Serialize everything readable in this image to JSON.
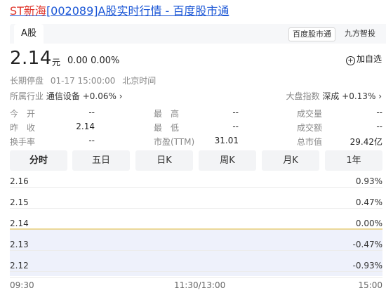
{
  "title": {
    "name_red": "ST新海",
    "rest": "[002089]A股实时行情 - 百度股市通"
  },
  "tabs": {
    "active": "A股",
    "source_primary": "百度股市通",
    "source_secondary": "九方智投"
  },
  "quote": {
    "price": "2.14",
    "unit": "元",
    "change": "0.00 0.00%",
    "add_label": "加自选",
    "status": [
      "长期停盘",
      "01-17 15:00:00",
      "北京时间"
    ],
    "industry_label": "所属行业",
    "industry_name": "通信设备",
    "industry_change": "+0.06%",
    "index_label": "大盘指数",
    "index_name": "深成",
    "index_change": "+0.13%"
  },
  "stats": [
    {
      "label": "今　开",
      "value": "--"
    },
    {
      "label": "最　高",
      "value": "--"
    },
    {
      "label": "成交量",
      "value": "--"
    },
    {
      "label": "昨　收",
      "value": "2.14"
    },
    {
      "label": "最　低",
      "value": "--"
    },
    {
      "label": "成交额",
      "value": "--"
    },
    {
      "label": "换手率",
      "value": "--"
    },
    {
      "label": "市盈(TTM)",
      "value": "31.01"
    },
    {
      "label": "总市值",
      "value": "29.42亿"
    }
  ],
  "periods": [
    "分时",
    "五日",
    "日K",
    "周K",
    "月K",
    "1年"
  ],
  "chart_data": {
    "type": "line",
    "y_labels": [
      "2.16",
      "2.15",
      "2.14",
      "2.13",
      "2.12"
    ],
    "pct_labels": [
      "0.93%",
      "0.47%",
      "0.00%",
      "-0.47%",
      "-0.93%"
    ],
    "x_labels": [
      "09:30",
      "11:30/13:00",
      "15:00"
    ],
    "ylim": [
      2.12,
      2.16
    ],
    "series": [
      {
        "x": [
          "09:30",
          "15:00"
        ],
        "values": [
          2.14,
          2.14
        ]
      }
    ],
    "colors": {
      "line": "#e8cf7a",
      "below_fill": "#eef1fb",
      "grid": "#ececec"
    }
  }
}
